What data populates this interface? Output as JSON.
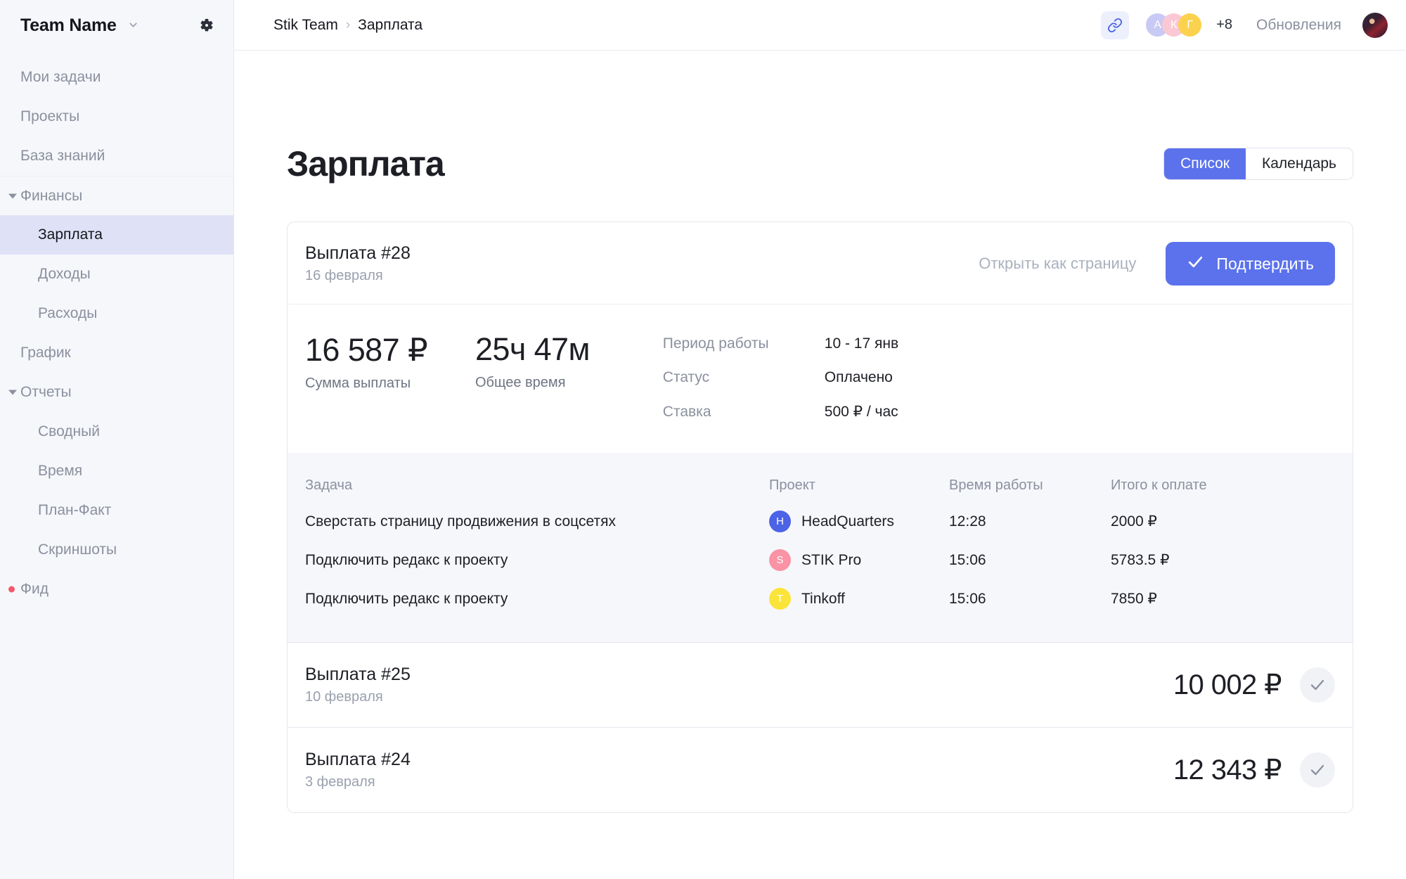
{
  "sidebar": {
    "team_name": "Team Name",
    "chevron_icon": "chevron-down-icon",
    "settings_icon": "gear-icon",
    "items": [
      {
        "label": "Мои задачи",
        "level": "top",
        "marker": "none",
        "active": false
      },
      {
        "label": "Проекты",
        "level": "top",
        "marker": "none",
        "active": false
      },
      {
        "label": "База знаний",
        "level": "top",
        "marker": "none",
        "active": false
      },
      {
        "label": "Финансы",
        "level": "group",
        "marker": "caret",
        "active": false
      },
      {
        "label": "Зарплата",
        "level": "sub",
        "marker": "none",
        "active": true
      },
      {
        "label": "Доходы",
        "level": "sub",
        "marker": "none",
        "active": false
      },
      {
        "label": "Расходы",
        "level": "sub",
        "marker": "none",
        "active": false
      },
      {
        "label": "График",
        "level": "top",
        "marker": "none",
        "active": false
      },
      {
        "label": "Отчеты",
        "level": "group",
        "marker": "caret",
        "active": false
      },
      {
        "label": "Сводный",
        "level": "sub",
        "marker": "none",
        "active": false
      },
      {
        "label": "Время",
        "level": "sub",
        "marker": "none",
        "active": false
      },
      {
        "label": "План-Факт",
        "level": "sub",
        "marker": "none",
        "active": false
      },
      {
        "label": "Скриншоты",
        "level": "sub",
        "marker": "none",
        "active": false
      },
      {
        "label": "Фид",
        "level": "top",
        "marker": "dot",
        "active": false
      }
    ]
  },
  "topbar": {
    "breadcrumb": {
      "root": "Stik Team",
      "separator": "›",
      "current": "Зарплата"
    },
    "link_icon": "link-icon",
    "avatars": [
      {
        "initial": "А",
        "color": "#c8c9f4"
      },
      {
        "initial": "К",
        "color": "#fac8d4"
      },
      {
        "initial": "Г",
        "color": "#fbd24e"
      }
    ],
    "avatar_overflow": "+8",
    "updates_label": "Обновления",
    "user_avatar": "user-avatar"
  },
  "page": {
    "title": "Зарплата",
    "view_tabs": [
      {
        "label": "Список",
        "active": true
      },
      {
        "label": "Календарь",
        "active": false
      }
    ]
  },
  "payment": {
    "title": "Выплата #28",
    "date": "16 февраля",
    "open_as_page_label": "Открыть как страницу",
    "confirm_label": "Подтвердить",
    "confirm_icon": "check-icon",
    "stats": [
      {
        "value": "16 587 ₽",
        "label": "Сумма выплаты"
      },
      {
        "value": "25ч 47м",
        "label": "Общее время"
      }
    ],
    "meta": [
      {
        "key": "Период работы",
        "value": "10 - 17 янв"
      },
      {
        "key": "Статус",
        "value": "Оплачено"
      },
      {
        "key": "Ставка",
        "value": "500 ₽ / час"
      }
    ],
    "table": {
      "columns": [
        "Задача",
        "Проект",
        "Время работы",
        "Итого к оплате"
      ],
      "rows": [
        {
          "task": "Сверстать страницу продвижения в соцсетях",
          "project": "HeadQuarters",
          "project_initial": "H",
          "project_color": "#4c63e6",
          "time": "12:28",
          "total": "2000 ₽"
        },
        {
          "task": "Подключить редакс к проекту",
          "project": "STIK Pro",
          "project_initial": "S",
          "project_color": "#fa93a6",
          "time": "15:06",
          "total": "5783.5 ₽"
        },
        {
          "task": "Подключить редакс к проекту",
          "project": "Tinkoff",
          "project_initial": "T",
          "project_color": "#fbe43a",
          "time": "15:06",
          "total": "7850 ₽"
        }
      ]
    }
  },
  "past_payments": [
    {
      "title": "Выплата #25",
      "date": "10 февраля",
      "amount": "10 002 ₽",
      "status_icon": "check-icon"
    },
    {
      "title": "Выплата #24",
      "date": "3 февраля",
      "amount": "12 343 ₽",
      "status_icon": "check-icon"
    }
  ],
  "colors": {
    "accent": "#5b72ec",
    "sidebar_bg": "#f6f7fb",
    "active_nav_bg": "#dfe2f6",
    "table_bg": "#f6f7fb",
    "feed_dot": "#f4596a"
  }
}
